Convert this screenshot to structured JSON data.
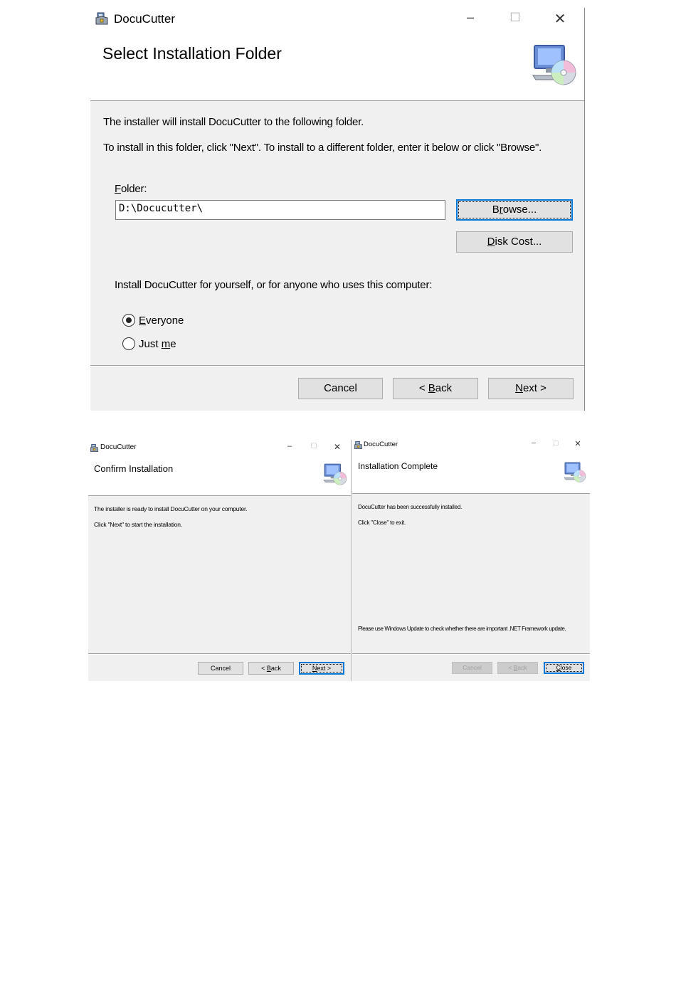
{
  "app_title": "DocuCutter",
  "window_controls": {
    "minimize": "–",
    "maximize": "☐",
    "close": "✕"
  },
  "dialog1": {
    "heading": "Select Installation Folder",
    "line1": "The installer will install DocuCutter to the following folder.",
    "line2": "To install in this folder, click \"Next\". To install to a different folder, enter it below or click \"Browse\".",
    "folder_label": {
      "u": "F",
      "rest": "older:"
    },
    "folder_value": "D:\\Docucutter\\",
    "browse": {
      "pre": "B",
      "u": "r",
      "post": "owse..."
    },
    "disk_cost": {
      "pre": "",
      "u": "D",
      "post": "isk Cost..."
    },
    "install_for": "Install DocuCutter for yourself, or for anyone who uses this computer:",
    "radio_everyone": {
      "pre": "",
      "u": "E",
      "post": "veryone",
      "selected": true
    },
    "radio_justme": {
      "pre": "Just ",
      "u": "m",
      "post": "e",
      "selected": false
    },
    "cancel": "Cancel",
    "back": {
      "pre": "< ",
      "u": "B",
      "post": "ack"
    },
    "next": {
      "pre": "",
      "u": "N",
      "post": "ext >"
    }
  },
  "dialog2": {
    "heading": "Confirm Installation",
    "line1": "The installer is ready to install DocuCutter on your computer.",
    "line2": "Click \"Next\" to start the installation.",
    "cancel": "Cancel",
    "back": {
      "pre": "< ",
      "u": "B",
      "post": "ack"
    },
    "next": {
      "pre": "",
      "u": "N",
      "post": "ext >"
    }
  },
  "dialog3": {
    "heading": "Installation Complete",
    "line1": "DocuCutter has been successfully installed.",
    "line2": "Click \"Close\" to exit.",
    "line3": "Please use Windows Update to check whether there are important .NET Framework update.",
    "cancel": "Cancel",
    "back": {
      "pre": "< ",
      "u": "B",
      "post": "ack"
    },
    "close": {
      "pre": "",
      "u": "C",
      "post": "lose"
    }
  },
  "colors": {
    "accent": "#0078d7",
    "dialog_bg": "#f0f0f0",
    "button_bg": "#e1e1e1"
  },
  "icons": [
    "installer-app-icon",
    "computer-cd-icon",
    "minimize-icon",
    "maximize-icon",
    "close-icon"
  ]
}
